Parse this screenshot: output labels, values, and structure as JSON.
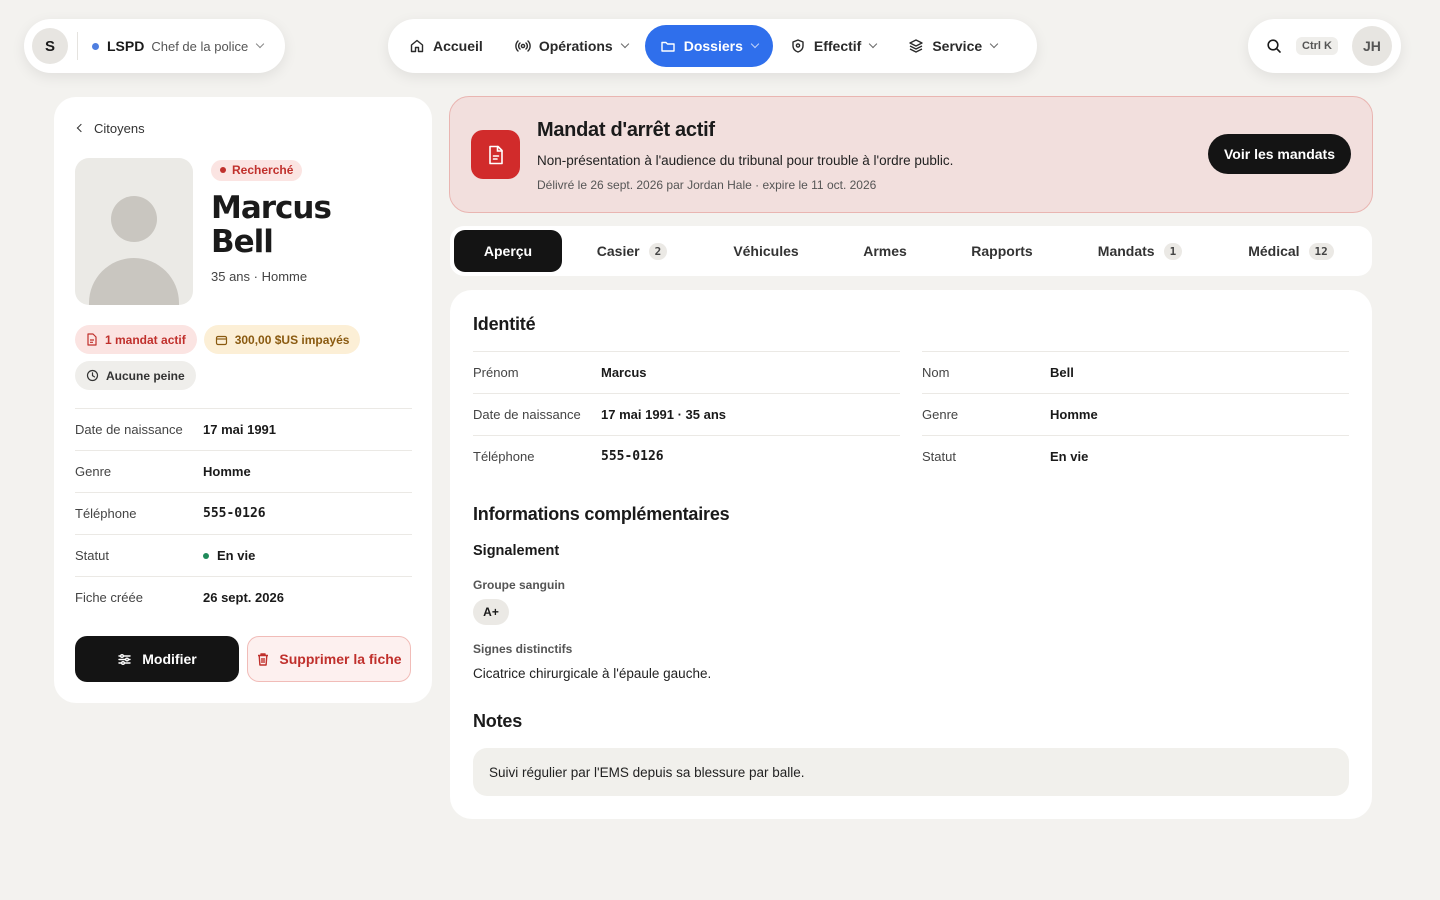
{
  "org": {
    "initial": "S",
    "name": "LSPD",
    "role": "Chef de la police"
  },
  "nav": {
    "accueil": "Accueil",
    "operations": "Opérations",
    "dossiers": "Dossiers",
    "effectif": "Effectif",
    "service": "Service"
  },
  "tools": {
    "shortcut": "Ctrl K",
    "user_initials": "JH"
  },
  "profile": {
    "back_label": "Citoyens",
    "status_badge": "Recherché",
    "first_name": "Marcus",
    "last_name": "Bell",
    "subtitle": "35 ans · Homme",
    "tags": {
      "warrant": "1 mandat actif",
      "fines": "300,00 $US impayés",
      "sentence": "Aucune peine"
    },
    "facts": [
      {
        "label": "Date de naissance",
        "value": "17 mai 1991"
      },
      {
        "label": "Genre",
        "value": "Homme"
      },
      {
        "label": "Téléphone",
        "value": "555-0126"
      },
      {
        "label": "Statut",
        "value": "En vie"
      },
      {
        "label": "Fiche créée",
        "value": "26 sept. 2026"
      }
    ],
    "edit_label": "Modifier",
    "delete_label": "Supprimer la fiche"
  },
  "alert": {
    "title": "Mandat d'arrêt actif",
    "description": "Non-présentation à l'audience du tribunal pour trouble à l'ordre public.",
    "meta": "Délivré le 26 sept. 2026 par Jordan Hale · expire le 11 oct. 2026",
    "button": "Voir les mandats",
    "accent": "#d12b2b"
  },
  "tabs": [
    {
      "label": "Aperçu",
      "count": null
    },
    {
      "label": "Casier",
      "count": "2"
    },
    {
      "label": "Véhicules",
      "count": null
    },
    {
      "label": "Armes",
      "count": null
    },
    {
      "label": "Rapports",
      "count": null
    },
    {
      "label": "Mandats",
      "count": "1"
    },
    {
      "label": "Médical",
      "count": "12"
    }
  ],
  "identity": {
    "title": "Identité",
    "left": [
      {
        "label": "Prénom",
        "value": "Marcus"
      },
      {
        "label": "Date de naissance",
        "value": "17 mai 1991 · 35 ans"
      },
      {
        "label": "Téléphone",
        "value": "555-0126"
      }
    ],
    "right": [
      {
        "label": "Nom",
        "value": "Bell"
      },
      {
        "label": "Genre",
        "value": "Homme"
      },
      {
        "label": "Statut",
        "value": "En vie"
      }
    ]
  },
  "more": {
    "title": "Informations complémentaires",
    "section": "Signalement",
    "blood_label": "Groupe sanguin",
    "blood_value": "A+",
    "marks_label": "Signes distinctifs",
    "marks_value": "Cicatrice chirurgicale à l'épaule gauche."
  },
  "notes": {
    "title": "Notes",
    "text": "Suivi régulier par l'EMS depuis sa blessure par balle."
  },
  "colors": {
    "brand": "#2f6fec",
    "danger": "#c0302c",
    "alive": "#1f8a5a"
  }
}
